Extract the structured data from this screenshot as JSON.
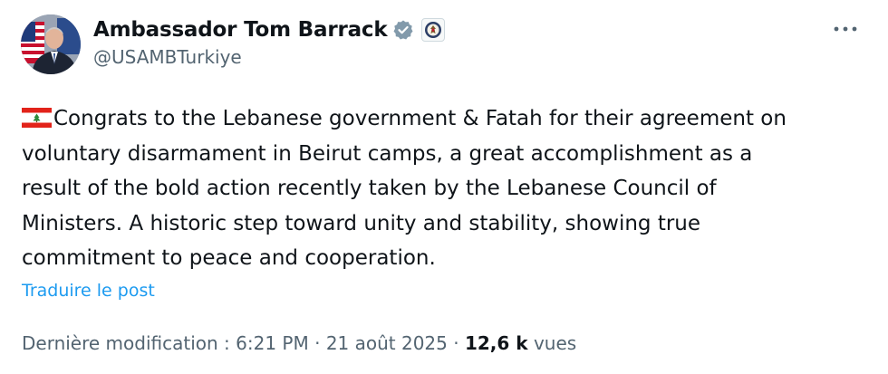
{
  "author": {
    "display_name": "Ambassador Tom Barrack",
    "handle": "@USAMBTurkiye",
    "avatar_icon": "ambassador-portrait-avatar",
    "verified_icon": "verified-badge-icon",
    "affiliation_icon": "us-state-department-seal-icon"
  },
  "menu": {
    "more_icon": "more-options-icon"
  },
  "post": {
    "flag_icon": "lebanon-flag-emoji",
    "lines": [
      "Congrats to the Lebanese government & Fatah for their agreement on",
      "voluntary disarmament in Beirut camps, a great accomplishment as a",
      "result of the bold action recently taken by the Lebanese Council of",
      "Ministers. A historic step toward unity and stability, showing true",
      "commitment to peace and cooperation."
    ],
    "translate_label": "Traduire le post"
  },
  "meta": {
    "edited_label": "Dernière modification : 6:21 PM",
    "separator": "·",
    "date": "21 août 2025",
    "views_count": "12,6 k",
    "views_label": "vues"
  },
  "colors": {
    "text": "#0f1419",
    "secondary": "#536471",
    "link": "#1d9bf0",
    "verified": "#829aab"
  }
}
